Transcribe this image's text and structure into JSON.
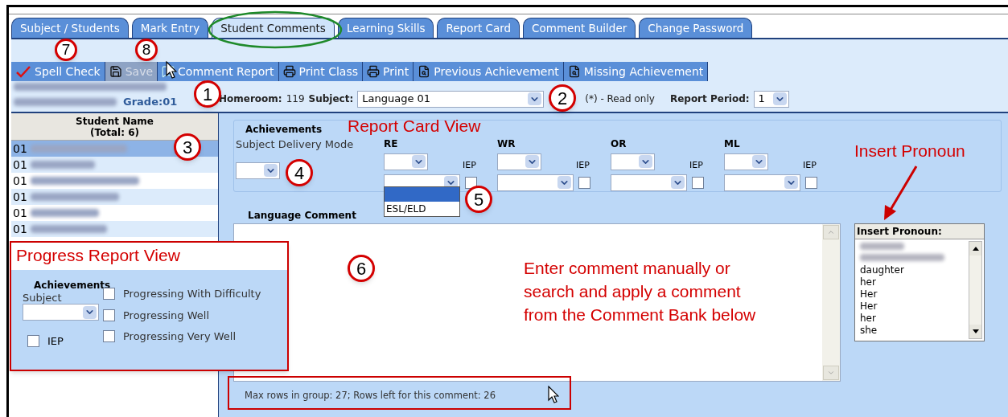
{
  "tabs": [
    {
      "label": "Subject / Students",
      "selected": false
    },
    {
      "label": "Mark Entry",
      "selected": false
    },
    {
      "label": "Student Comments",
      "selected": true
    },
    {
      "label": "Learning Skills",
      "selected": false
    },
    {
      "label": "Report Card",
      "selected": false
    },
    {
      "label": "Comment Builder",
      "selected": false
    },
    {
      "label": "Change Password",
      "selected": false
    }
  ],
  "toolbar": [
    {
      "label": "Spell Check",
      "kind": "spell",
      "disabled": false
    },
    {
      "label": "Save",
      "kind": "save",
      "disabled": true
    },
    {
      "label": "Comment Report",
      "kind": "comment",
      "disabled": false
    },
    {
      "label": "Print Class",
      "kind": "print",
      "disabled": false
    },
    {
      "label": "Print",
      "kind": "print",
      "disabled": false
    },
    {
      "label": "Previous Achievement",
      "kind": "preview",
      "disabled": false
    },
    {
      "label": "Missing Achievement",
      "kind": "preview",
      "disabled": false
    }
  ],
  "header": {
    "grade": "Grade:01",
    "homeroom_label": "Homeroom:",
    "homeroom": "119",
    "subject_label": "Subject:",
    "subject": "Language 01",
    "read_only_note": "(*) - Read only",
    "report_period_label": "Report Period:",
    "report_period": "1"
  },
  "students": {
    "header": "Student Name",
    "total": "(Total: 6)",
    "rows": [
      {
        "number": "01",
        "selected": true
      },
      {
        "number": "01",
        "selected": false
      },
      {
        "number": "01",
        "selected": false
      },
      {
        "number": "01",
        "selected": false
      },
      {
        "number": "01",
        "selected": false
      },
      {
        "number": "01",
        "selected": false
      }
    ]
  },
  "achievements": {
    "title": "Achievements",
    "delivery_mode_label": "Subject Delivery Mode",
    "strands": [
      {
        "label": "RE",
        "iep_label": "IEP",
        "iep": false,
        "open_options": [
          "ESL/ELD"
        ]
      },
      {
        "label": "WR",
        "iep_label": "IEP",
        "iep": false
      },
      {
        "label": "OR",
        "iep_label": "IEP",
        "iep": false
      },
      {
        "label": "ML",
        "iep_label": "IEP",
        "iep": false
      }
    ]
  },
  "comment": {
    "label": "Language Comment",
    "counter": "Max rows in group: 27; Rows left for this comment: 26"
  },
  "pronouns": {
    "title": "Insert Pronoun:",
    "items": [
      "daughter",
      "her",
      "Her",
      "Her",
      "her",
      "she"
    ]
  },
  "progress_report": {
    "title": "Progress Report View",
    "achievements": "Achievements",
    "subject_label": "Subject",
    "iep_label": "IEP",
    "iep": false,
    "options": [
      {
        "label": "Progressing With Difficulty",
        "checked": false
      },
      {
        "label": "Progressing Well",
        "checked": false
      },
      {
        "label": "Progressing Very Well",
        "checked": false
      }
    ]
  },
  "annotations": {
    "report_card_view": "Report Card View",
    "insert_pronoun": "Insert Pronoun",
    "instructions": "Enter comment manually or search and apply a comment from the Comment Bank below",
    "markers": [
      "7",
      "8",
      "1",
      "2",
      "3",
      "4",
      "5",
      "6"
    ]
  }
}
